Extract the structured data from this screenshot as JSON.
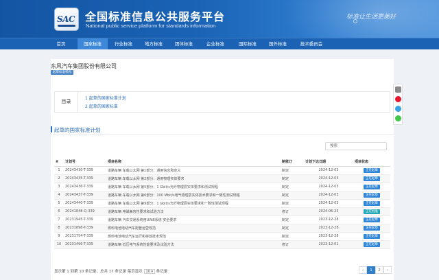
{
  "header": {
    "logo_text": "SAC",
    "title": "全国标准信息公共服务平台",
    "subtitle": "National public service platform  for standards information",
    "slogan": "标准让生活更美好"
  },
  "nav": {
    "items": [
      "首页",
      "国家标准",
      "行业标准",
      "地方标准",
      "团体标准",
      "企业标准",
      "国际标准",
      "国外标准",
      "技术委员会"
    ],
    "active": "国家标准"
  },
  "company": {
    "name": "东风汽车集团股份有限公司",
    "badge": "起草标准机构"
  },
  "toc": {
    "label": "目录",
    "items": [
      "1  起草的国家标准计划",
      "2  起草的国家标准"
    ]
  },
  "section": {
    "title": "起草的国家标准计划"
  },
  "search": {
    "placeholder": "搜索"
  },
  "table": {
    "headers": [
      "#",
      "计划号",
      "项目名称",
      "制修订",
      "计划下达日期",
      "项目状态"
    ],
    "rows": [
      {
        "n": "1",
        "code": "20243430-T-339",
        "name": "道路车辆 车载以太网 第1部分：通用信息和定义",
        "type": "制定",
        "date": "2024-12-03",
        "status": "正在起草"
      },
      {
        "n": "2",
        "code": "20243435-T-339",
        "name": "道路车辆 车载以太网 第2部分：通用物理实体要求",
        "type": "制定",
        "date": "2024-12-03",
        "status": "正在起草"
      },
      {
        "n": "3",
        "code": "20243436-T-339",
        "name": "道路车辆 车载以太网 第5部分：1 Gbit/s光纤物理层实体要求和测试规程",
        "type": "制定",
        "date": "2024-12-03",
        "status": "正在起草"
      },
      {
        "n": "4",
        "code": "20243437-T-339",
        "name": "道路车辆 车载以太网 第6部分：100 Mbit/s电气物理层实体技术要求和一致性测试规程",
        "type": "制定",
        "date": "2024-12-03",
        "status": "正在起草"
      },
      {
        "n": "5",
        "code": "20243440-T-339",
        "name": "道路车辆 车载以太网 第9部分：1 Gbit/s光纤物理层实体要求和一致性测试规程",
        "type": "制定",
        "date": "2024-12-03",
        "status": "正在起草"
      },
      {
        "n": "6",
        "code": "20241848-Q-339",
        "name": "道路车辆 电磁兼容性要求和试验方法",
        "type": "修订",
        "date": "2024-06-25",
        "status": "正在批准"
      },
      {
        "n": "7",
        "code": "20231945-T-339",
        "name": "道路车辆 汽车交通系统用UWB系统 安全要求",
        "type": "制定",
        "date": "2023-12-28",
        "status": "正在起草"
      },
      {
        "n": "8",
        "code": "20231898-T-339",
        "name": "燃料电池电动汽车配套运营规范",
        "type": "制定",
        "date": "2023-12-28",
        "status": "正在起草"
      },
      {
        "n": "9",
        "code": "20231754-T-339",
        "name": "燃料电池电动汽车运行和存放技术规范",
        "type": "制定",
        "date": "2023-12-28",
        "status": "正在起草"
      },
      {
        "n": "10",
        "code": "20231499-T-339",
        "name": "道路车辆 低压电气系统性能要求及试验方法",
        "type": "修订",
        "date": "2023-12-01",
        "status": "正在起草"
      }
    ]
  },
  "pagination": {
    "summary_before": "显示第 1 到第 10 条记录，总共 17 条记录 每页显示",
    "page_size": "10",
    "summary_after": "条记录",
    "pages": [
      "‹",
      "1",
      "2",
      "›"
    ],
    "active_page": "1"
  },
  "colors": {
    "header_blue": "#1455a3",
    "nav_active": "#3d88d8",
    "link_blue": "#2a6cb5",
    "status_drafting": "#2f86d6",
    "status_approving": "#22a9b8"
  },
  "share_icons": [
    "share-icon",
    "weibo-icon",
    "qq-icon",
    "wechat-icon"
  ]
}
